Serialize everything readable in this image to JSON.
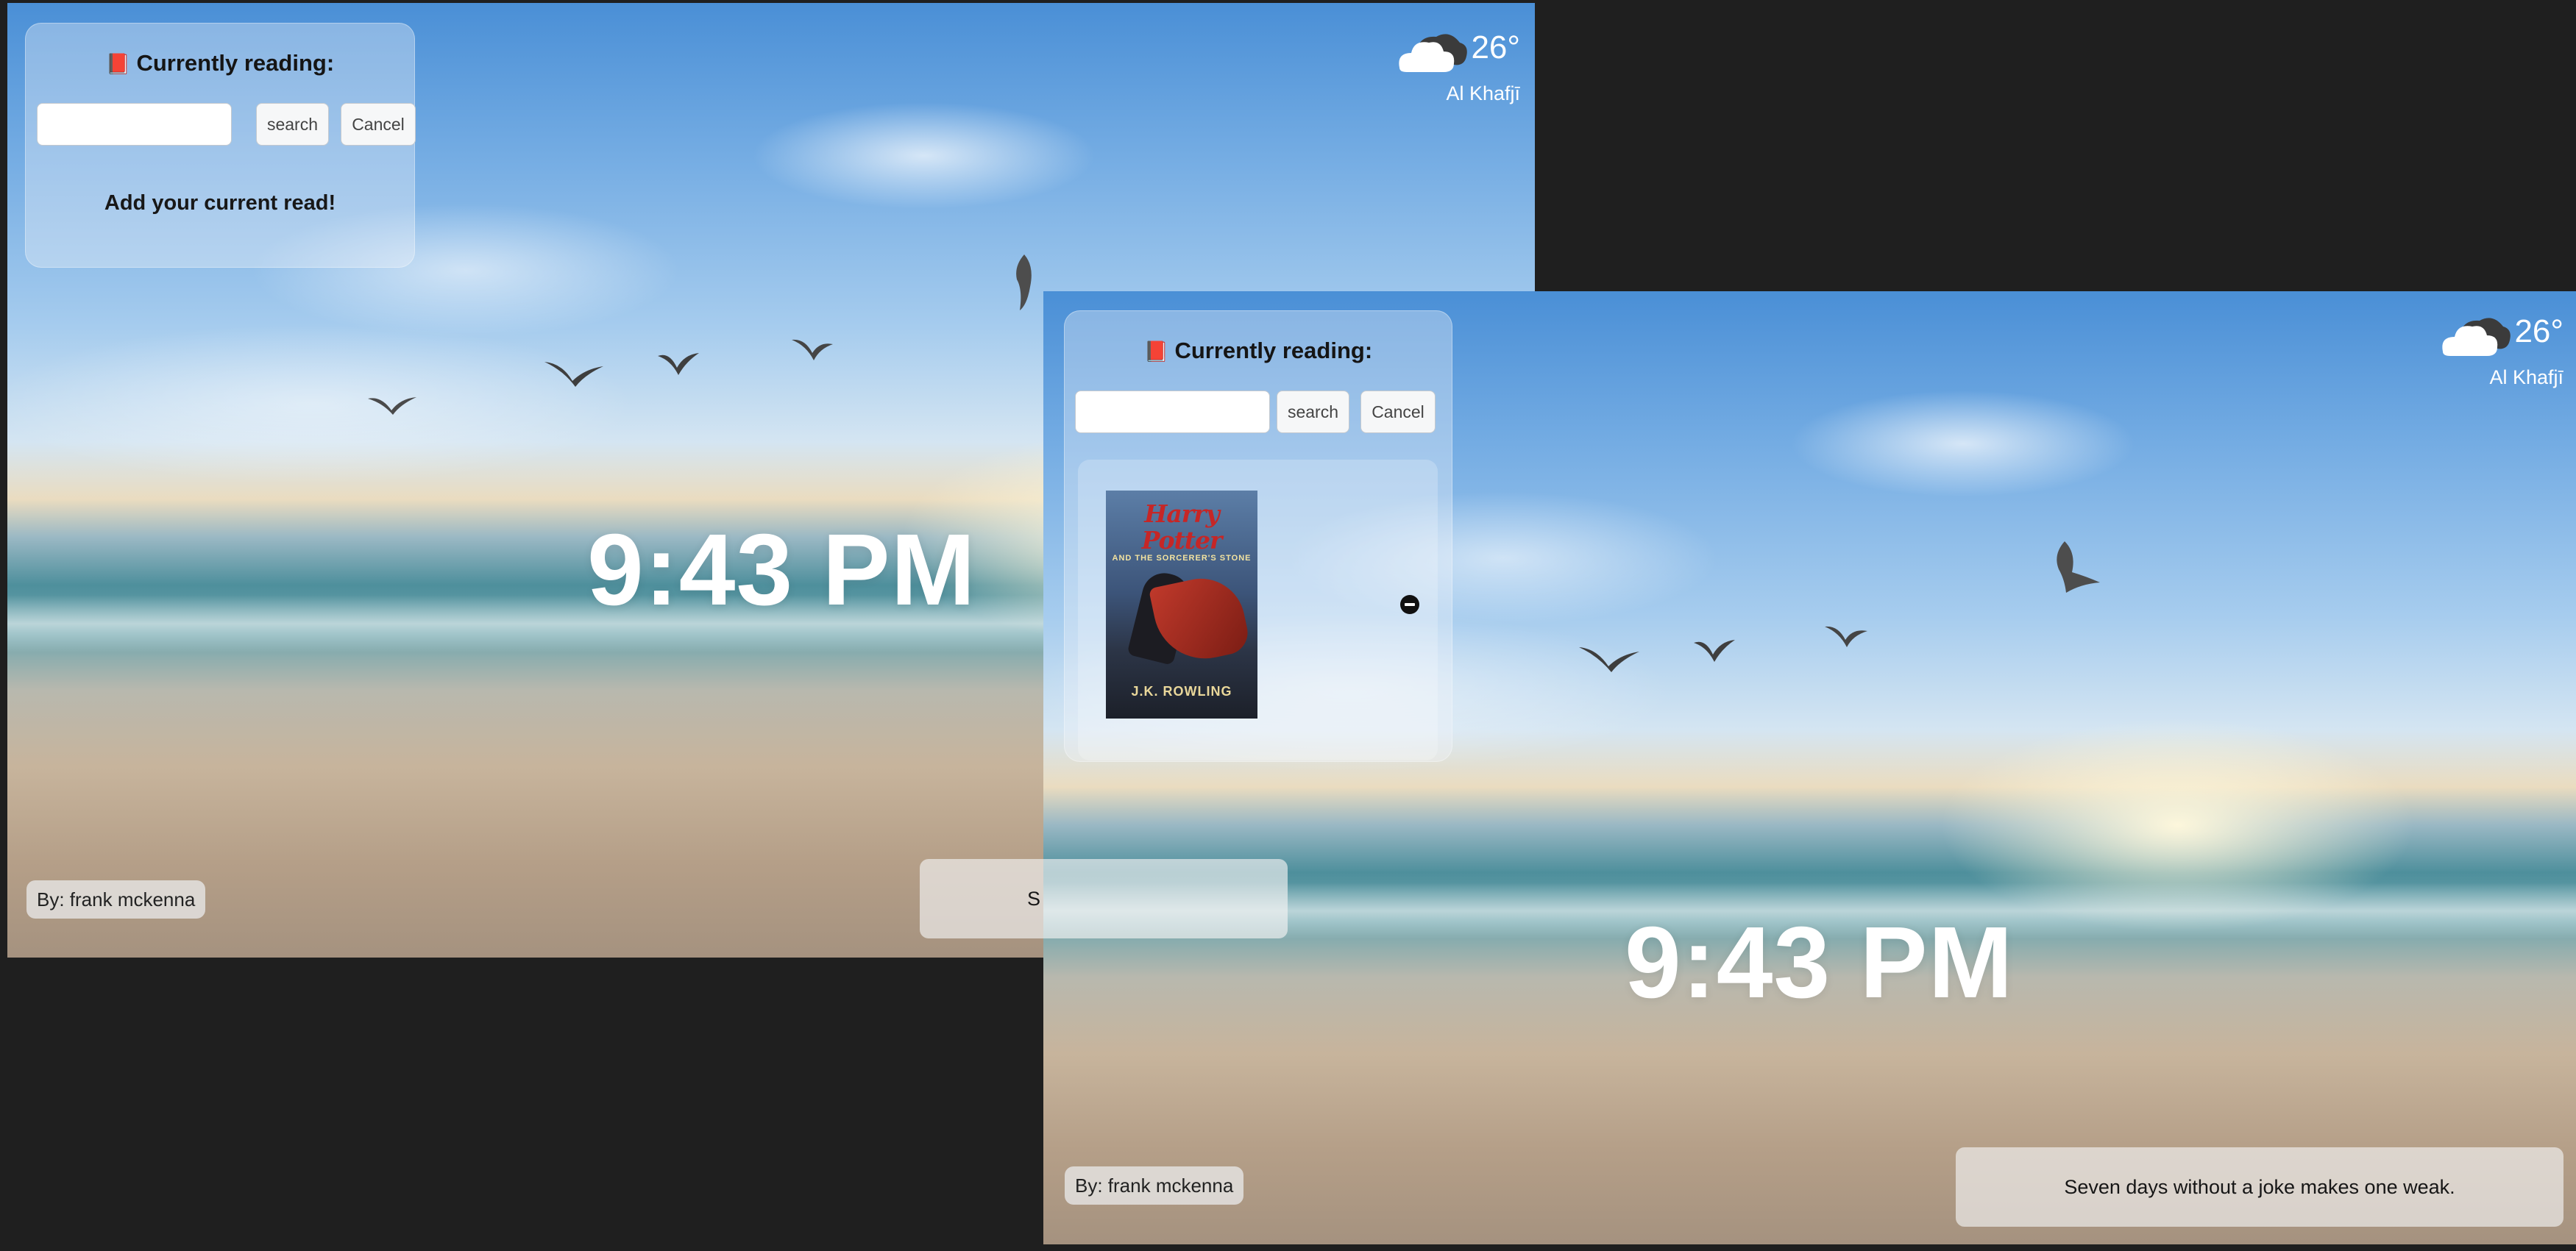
{
  "screens": [
    {
      "reading": {
        "title": "Currently reading:",
        "icon": "book-icon",
        "search_value": "",
        "search_label": "search",
        "cancel_label": "Cancel",
        "empty_text": "Add your current read!"
      },
      "weather": {
        "icon": "cloud-icon",
        "temperature": "26°",
        "location": "Al Khafjī"
      },
      "time": "9:43 PM",
      "credit": "By: frank mckenna",
      "quote_partial": "S"
    },
    {
      "reading": {
        "title": "Currently reading:",
        "icon": "book-icon",
        "search_value": "",
        "search_label": "search",
        "cancel_label": "Cancel",
        "book": {
          "cover_title": "Harry Potter",
          "cover_subtitle": "AND THE SORCERER'S STONE",
          "cover_author": "J.K. ROWLING",
          "remove_icon": "minus-circle-icon"
        }
      },
      "weather": {
        "icon": "cloud-icon",
        "temperature": "26°",
        "location": "Al Khafjī"
      },
      "time": "9:43 PM",
      "credit": "By: frank mckenna",
      "quote": "Seven days without a joke makes one weak."
    }
  ],
  "colors": {
    "page_background": "#1f1f1f",
    "panel_glass": "rgba(240,245,250,0.36)",
    "remove_button": "#111111"
  }
}
